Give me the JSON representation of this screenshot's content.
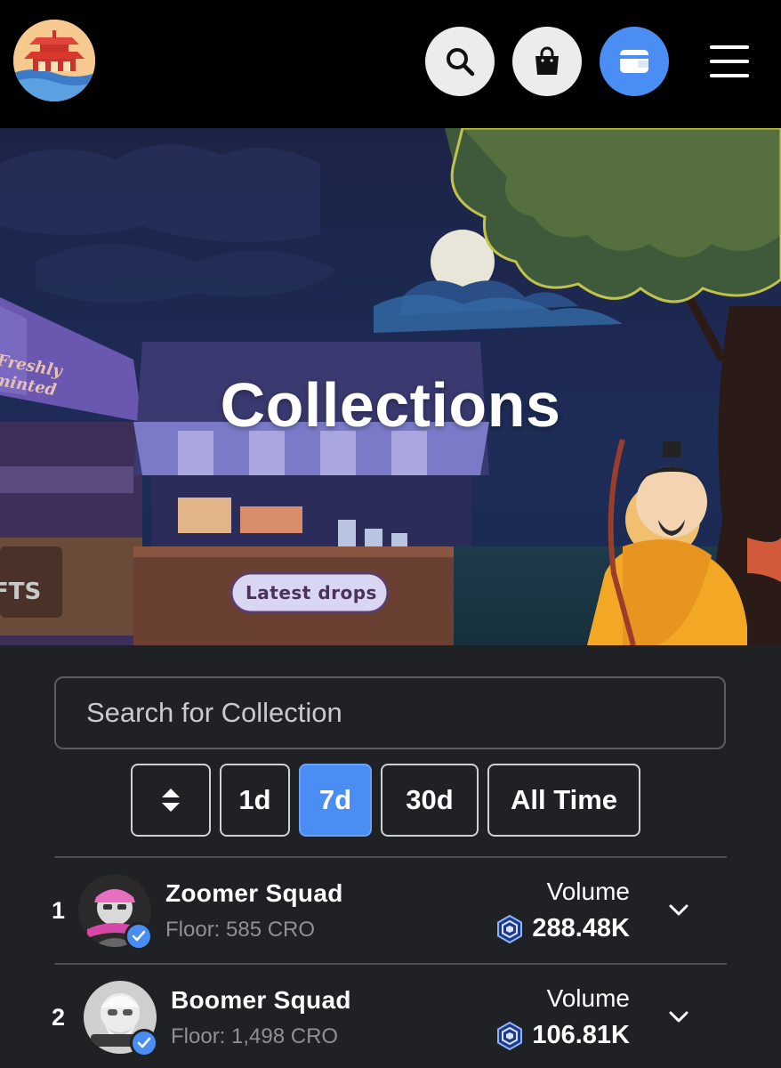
{
  "header": {
    "logo_icon": "pagoda-logo-icon",
    "search_icon": "search-icon",
    "bag_icon": "shopping-bag-icon",
    "wallet_icon": "wallet-icon",
    "menu_icon": "hamburger-menu-icon",
    "wallet_color": "#4b8ef3"
  },
  "hero": {
    "title": "Collections",
    "sign_left": "Freshly minted",
    "sign_counter": "Latest drops",
    "sign_side": "FTS"
  },
  "search": {
    "placeholder": "Search for Collection"
  },
  "filters": {
    "sort_icon": "sort-icon",
    "options": [
      "1d",
      "7d",
      "30d",
      "All Time"
    ],
    "selected": "7d",
    "accent": "#4b8ef3"
  },
  "collections": [
    {
      "rank": "1",
      "name": "Zoomer Squad",
      "floor": "Floor: 585 CRO",
      "volume_label": "Volume",
      "volume": "288.48K",
      "verified": true
    },
    {
      "rank": "2",
      "name": "Boomer Squad",
      "floor": "Floor: 1,498 CRO",
      "volume_label": "Volume",
      "volume": "106.81K",
      "verified": true
    }
  ]
}
